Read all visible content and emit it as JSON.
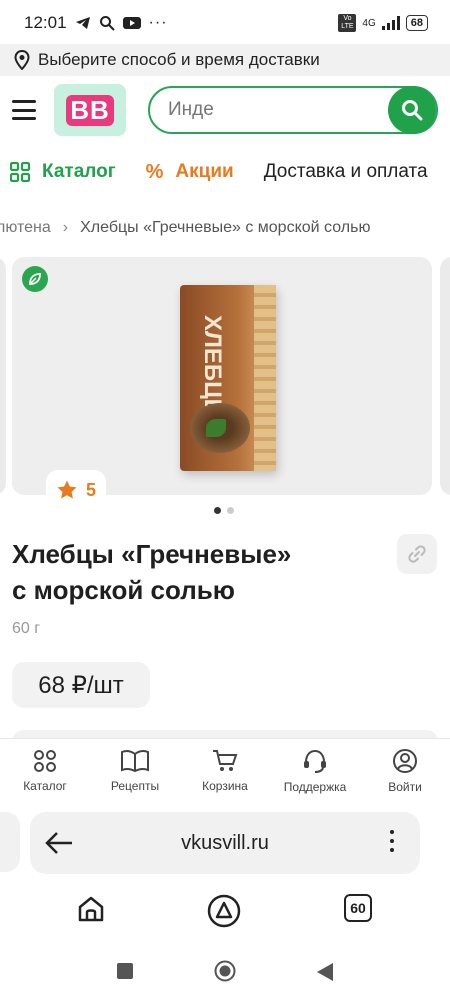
{
  "status_bar": {
    "time": "12:01",
    "net": "4G",
    "lte": "Vo LTE",
    "battery": "68"
  },
  "delivery": {
    "text": "Выберите способ и время доставки"
  },
  "header": {
    "logo_text": "ВВ",
    "search_placeholder": "Инде"
  },
  "nav": {
    "catalog": "Каталог",
    "promo": "Акции",
    "delivery": "Доставка и оплата"
  },
  "breadcrumbs": [
    "лютена",
    "Хлебцы «Гречневые» с морской солью"
  ],
  "product": {
    "pack_label": "ХЛЕБЦЫ",
    "rating": "5",
    "title_line1": "Хлебцы «Гречневые»",
    "title_line2": "с морской солью",
    "weight": "60 г",
    "price": "68 ₽/шт"
  },
  "tabbar": [
    {
      "label": "Каталог",
      "icon": "catalog-icon"
    },
    {
      "label": "Рецепты",
      "icon": "book-icon"
    },
    {
      "label": "Корзина",
      "icon": "cart-icon"
    },
    {
      "label": "Поддержка",
      "icon": "headset-icon"
    },
    {
      "label": "Войти",
      "icon": "user-icon"
    }
  ],
  "browser": {
    "url": "vkusvill.ru",
    "tab_count": "60"
  },
  "colors": {
    "brand_green": "#1fa24a",
    "promo_orange": "#e97a1d"
  }
}
